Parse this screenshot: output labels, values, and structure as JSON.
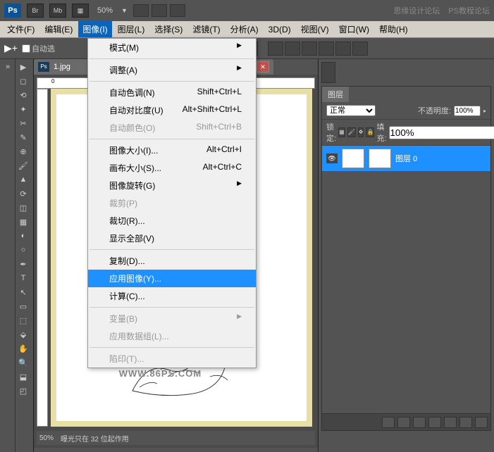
{
  "topbar": {
    "logo": "Ps",
    "btn1": "Br",
    "btn2": "Mb",
    "zoom": "50%",
    "watermark1": "思缘设计论坛",
    "watermark2": "PS教程论坛"
  },
  "menu": {
    "items": [
      "文件(F)",
      "编辑(E)",
      "图像(I)",
      "图层(L)",
      "选择(S)",
      "滤镜(T)",
      "分析(A)",
      "3D(D)",
      "视图(V)",
      "窗口(W)",
      "帮助(H)"
    ]
  },
  "options": {
    "autoselect": "自动选"
  },
  "doc": {
    "title": "1.jpg",
    "zoom": "50%",
    "watermark": "PS 资源网    WWW.86PS.COM",
    "status": "曝光只在 32 位起作用"
  },
  "dropdown": {
    "items": [
      {
        "label": "模式(M)",
        "shortcut": "",
        "arrow": true,
        "sep": true
      },
      {
        "label": "调整(A)",
        "shortcut": "",
        "arrow": true,
        "sep": true
      },
      {
        "label": "自动色调(N)",
        "shortcut": "Shift+Ctrl+L"
      },
      {
        "label": "自动对比度(U)",
        "shortcut": "Alt+Shift+Ctrl+L"
      },
      {
        "label": "自动颜色(O)",
        "shortcut": "Shift+Ctrl+B",
        "disabled": true,
        "sep": true
      },
      {
        "label": "图像大小(I)...",
        "shortcut": "Alt+Ctrl+I"
      },
      {
        "label": "画布大小(S)...",
        "shortcut": "Alt+Ctrl+C"
      },
      {
        "label": "图像旋转(G)",
        "shortcut": "",
        "arrow": true
      },
      {
        "label": "裁剪(P)",
        "shortcut": "",
        "disabled": true
      },
      {
        "label": "裁切(R)...",
        "shortcut": ""
      },
      {
        "label": "显示全部(V)",
        "shortcut": "",
        "sep": true
      },
      {
        "label": "复制(D)...",
        "shortcut": ""
      },
      {
        "label": "应用图像(Y)...",
        "shortcut": "",
        "highlight": true
      },
      {
        "label": "计算(C)...",
        "shortcut": "",
        "sep": true
      },
      {
        "label": "变量(B)",
        "shortcut": "",
        "arrow": true,
        "disabled": true
      },
      {
        "label": "应用数据组(L)...",
        "shortcut": "",
        "disabled": true,
        "sep": true
      },
      {
        "label": "陷印(T)...",
        "shortcut": "",
        "disabled": true
      }
    ]
  },
  "layers": {
    "tab": "图层",
    "blendmode": "正常",
    "opacity_label": "不透明度:",
    "opacity": "100%",
    "lock_label": "锁定:",
    "fill_label": "填充:",
    "fill": "100%",
    "layer0": "图层 0"
  }
}
